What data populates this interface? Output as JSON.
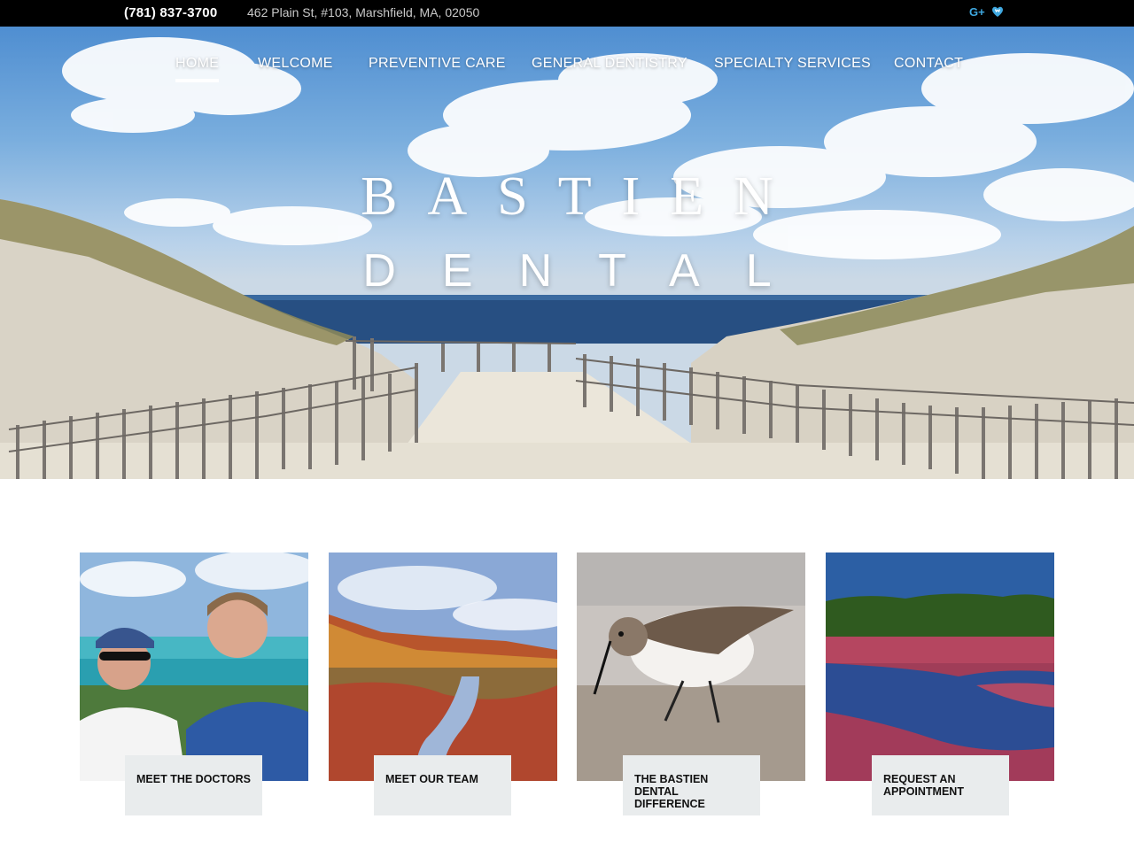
{
  "topbar": {
    "phone": "(781) 837-3700",
    "address": "462 Plain St, #103, Marshfield, MA, 02050",
    "social": [
      {
        "icon": "google-plus-icon",
        "label": "G+"
      },
      {
        "icon": "heart-tooth-icon"
      }
    ]
  },
  "nav": {
    "items": [
      {
        "label": "HOME",
        "active": true
      },
      {
        "label": "WELCOME"
      },
      {
        "label": "PREVENTIVE CARE"
      },
      {
        "label": "GENERAL DENTISTRY"
      },
      {
        "label": "SPECIALTY SERVICES"
      },
      {
        "label": "CONTACT"
      }
    ]
  },
  "hero": {
    "brand_line1": "BASTIEN",
    "brand_line2": "DENTAL"
  },
  "cards": [
    {
      "label": "MEET THE DOCTORS"
    },
    {
      "label": "MEET OUR TEAM"
    },
    {
      "label": "THE BASTIEN DENTAL DIFFERENCE"
    },
    {
      "label": "REQUEST AN APPOINTMENT"
    }
  ],
  "colors": {
    "topbar_bg": "#000000",
    "card_label_bg": "#e9eced",
    "accent_blue": "#3fa8e0"
  }
}
